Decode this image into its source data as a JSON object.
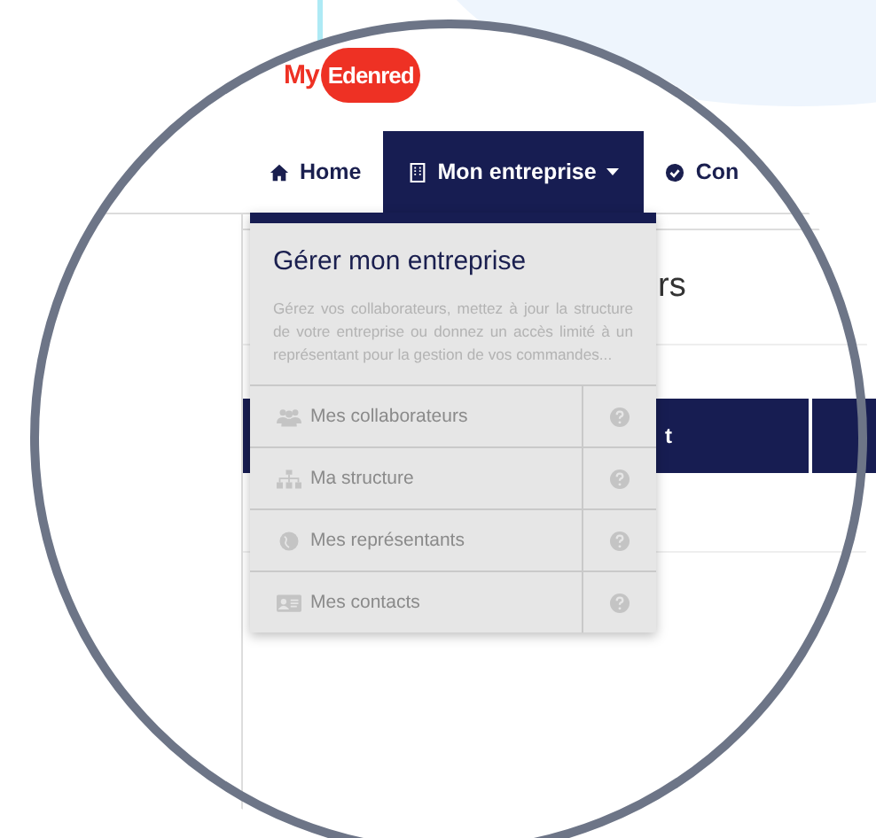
{
  "logo": {
    "prefix": "My",
    "name": "Edenred"
  },
  "nav": [
    {
      "label": "Home",
      "kind": "home",
      "selected": false,
      "dropdown": false
    },
    {
      "label": "Mon entreprise",
      "kind": "building",
      "selected": true,
      "dropdown": true
    },
    {
      "label": "Con",
      "kind": "check",
      "selected": false,
      "dropdown": false
    }
  ],
  "dropdown": {
    "title": "Gérer mon entreprise",
    "description": "Gérez vos collaborateurs, mettez à jour la structure de votre entreprise ou donnez un accès limité à un représentant pour la gestion de vos commandes...",
    "items": [
      {
        "label": "Mes collaborateurs",
        "kind": "people"
      },
      {
        "label": "Ma structure",
        "kind": "sitemap"
      },
      {
        "label": "Mes représentants",
        "kind": "globe"
      },
      {
        "label": "Mes contacts",
        "kind": "card"
      }
    ]
  },
  "page": {
    "heading": "rs",
    "table_header": [
      "t"
    ]
  }
}
